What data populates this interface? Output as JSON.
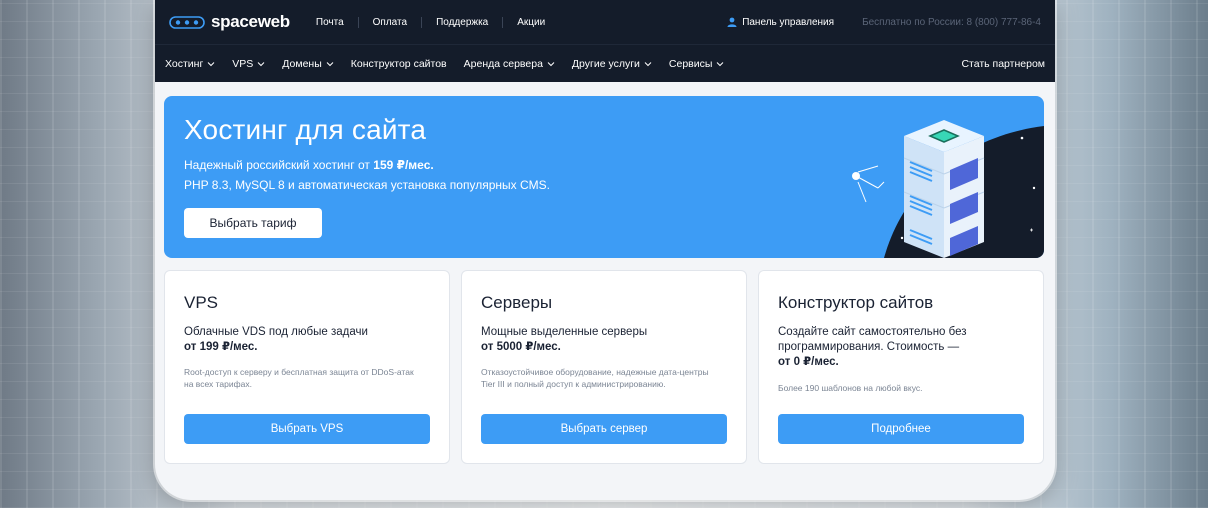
{
  "brand": {
    "name": "spaceweb"
  },
  "topnav": [
    "Почта",
    "Оплата",
    "Поддержка",
    "Акции"
  ],
  "topright": {
    "panel": "Панель управления",
    "phone": "Бесплатно по России: 8 (800) 777-86-4"
  },
  "mainnav": {
    "items": [
      "Хостинг",
      "VPS",
      "Домены",
      "Конструктор сайтов",
      "Аренда сервера",
      "Другие услуги",
      "Сервисы"
    ],
    "partner": "Стать партнером"
  },
  "hero": {
    "title": "Хостинг для сайта",
    "line1_text": "Надежный российский хостинг от ",
    "line1_price": "159 ₽/мес.",
    "line2": "PHP 8.3, MySQL 8 и автоматическая установка популярных CMS.",
    "button": "Выбрать тариф"
  },
  "cards": [
    {
      "title": "VPS",
      "desc": "Облачные VDS под любые задачи",
      "price": "от 199 ₽/мес.",
      "note": "Root-доступ к серверу и бесплатная защита от DDoS-атак на всех тарифах.",
      "button": "Выбрать VPS"
    },
    {
      "title": "Серверы",
      "desc": "Мощные выделенные серверы",
      "price": "от 5000 ₽/мес.",
      "note": "Отказоустойчивое оборудование, надежные дата-центры Tier III и полный доступ к администрированию.",
      "button": "Выбрать сервер"
    },
    {
      "title": "Конструктор сайтов",
      "desc": "Создайте сайт самостоятельно без программирования. Стоимость —",
      "price": "от 0 ₽/мес.",
      "note": "Более 190 шаблонов на любой вкус.",
      "button": "Подробнее"
    }
  ],
  "colors": {
    "accent": "#3d9cf5",
    "header": "#141c2a"
  },
  "icons": [
    "spaceweb-logo-icon",
    "user-icon",
    "chevron-down-icon",
    "server-stack-illustration",
    "satellite-icon"
  ]
}
